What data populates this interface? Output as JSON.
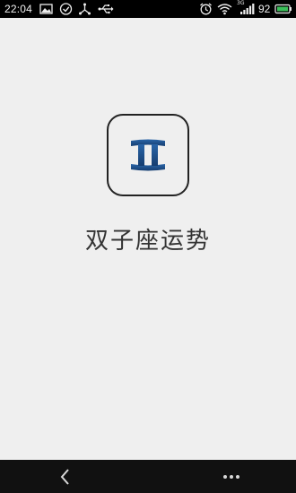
{
  "status_bar": {
    "time": "22:04",
    "battery_level": "92",
    "network_type": "3G",
    "icons": [
      "image-icon",
      "check-circle-icon",
      "usb-debug-icon",
      "usb-icon",
      "alarm-icon",
      "wifi-icon",
      "signal-icon",
      "battery-icon"
    ]
  },
  "app": {
    "title": "双子座运势",
    "icon": "gemini-zodiac-icon",
    "icon_color": "#1d4f8a"
  },
  "nav_bar": {
    "back": "back-chevron-icon",
    "menu": "more-dots-icon"
  }
}
